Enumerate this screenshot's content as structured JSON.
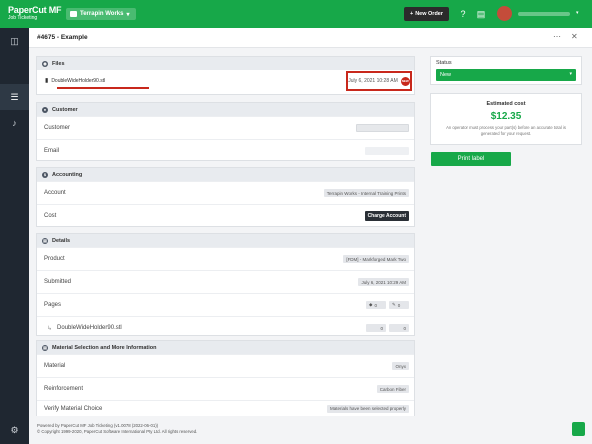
{
  "topbar": {
    "brand_name": "PaperCut MF",
    "brand_sub": "Job Ticketing",
    "org_label": "Terrapin Works",
    "new_order_label": "New Order",
    "avatar_initials": ""
  },
  "header": {
    "title": "#4675 - Example"
  },
  "files": {
    "heading": "Files",
    "filename": "DoubleWideHolder90.stl",
    "date": "July 6, 2021 10:28 AM",
    "badge": "NEW"
  },
  "customer": {
    "heading": "Customer",
    "rows": [
      {
        "label": "Customer"
      },
      {
        "label": "Email"
      }
    ]
  },
  "accounting": {
    "heading": "Accounting",
    "account_label": "Account",
    "account_value": "Terrapin Works - Internal Training Prints",
    "cost_label": "Cost",
    "charge_button": "Charge Account"
  },
  "details": {
    "heading": "Details",
    "product_label": "Product",
    "product_value": "[FDM] - Markforged Mark Two",
    "submitted_label": "Submitted",
    "submitted_value": "July 6, 2021 10:29 AM",
    "pages_label": "Pages",
    "pages_a": "0",
    "pages_b": "0",
    "file_label": "DoubleWideHolder90.stl",
    "file_a": "0",
    "file_b": "0"
  },
  "material": {
    "heading": "Material Selection and More Information",
    "material_label": "Material",
    "material_value": "Onyx",
    "reinforcement_label": "Reinforcement",
    "reinforcement_value": "Carbon Fiber",
    "verify_label": "Verify Material Choice",
    "verify_value": "Materials have been selected properly"
  },
  "status": {
    "label": "Status",
    "value": "New"
  },
  "cost": {
    "title": "Estimated cost",
    "value": "$12.35",
    "note": "An operator must process your part(s) before an accurate total is generated for your request."
  },
  "print_label": "Print label",
  "footer": {
    "line1": "Powered by PaperCut MF Job Ticketing (v1.0078 (2022-06-01))",
    "line2": "© Copyright 1999-2020, PaperCut Software International Pty Ltd. All rights reserved."
  },
  "colors": {
    "brand_green": "#17a849",
    "sidebar_dark": "#1f2731",
    "highlight_red": "#c8281c"
  },
  "icons": [
    "plus-icon",
    "help-icon",
    "chat-icon",
    "columns-icon",
    "list-icon",
    "bell-icon",
    "gear-icon",
    "eye-icon",
    "user-icon",
    "dollar-icon",
    "file-icon",
    "doc-icon"
  ]
}
